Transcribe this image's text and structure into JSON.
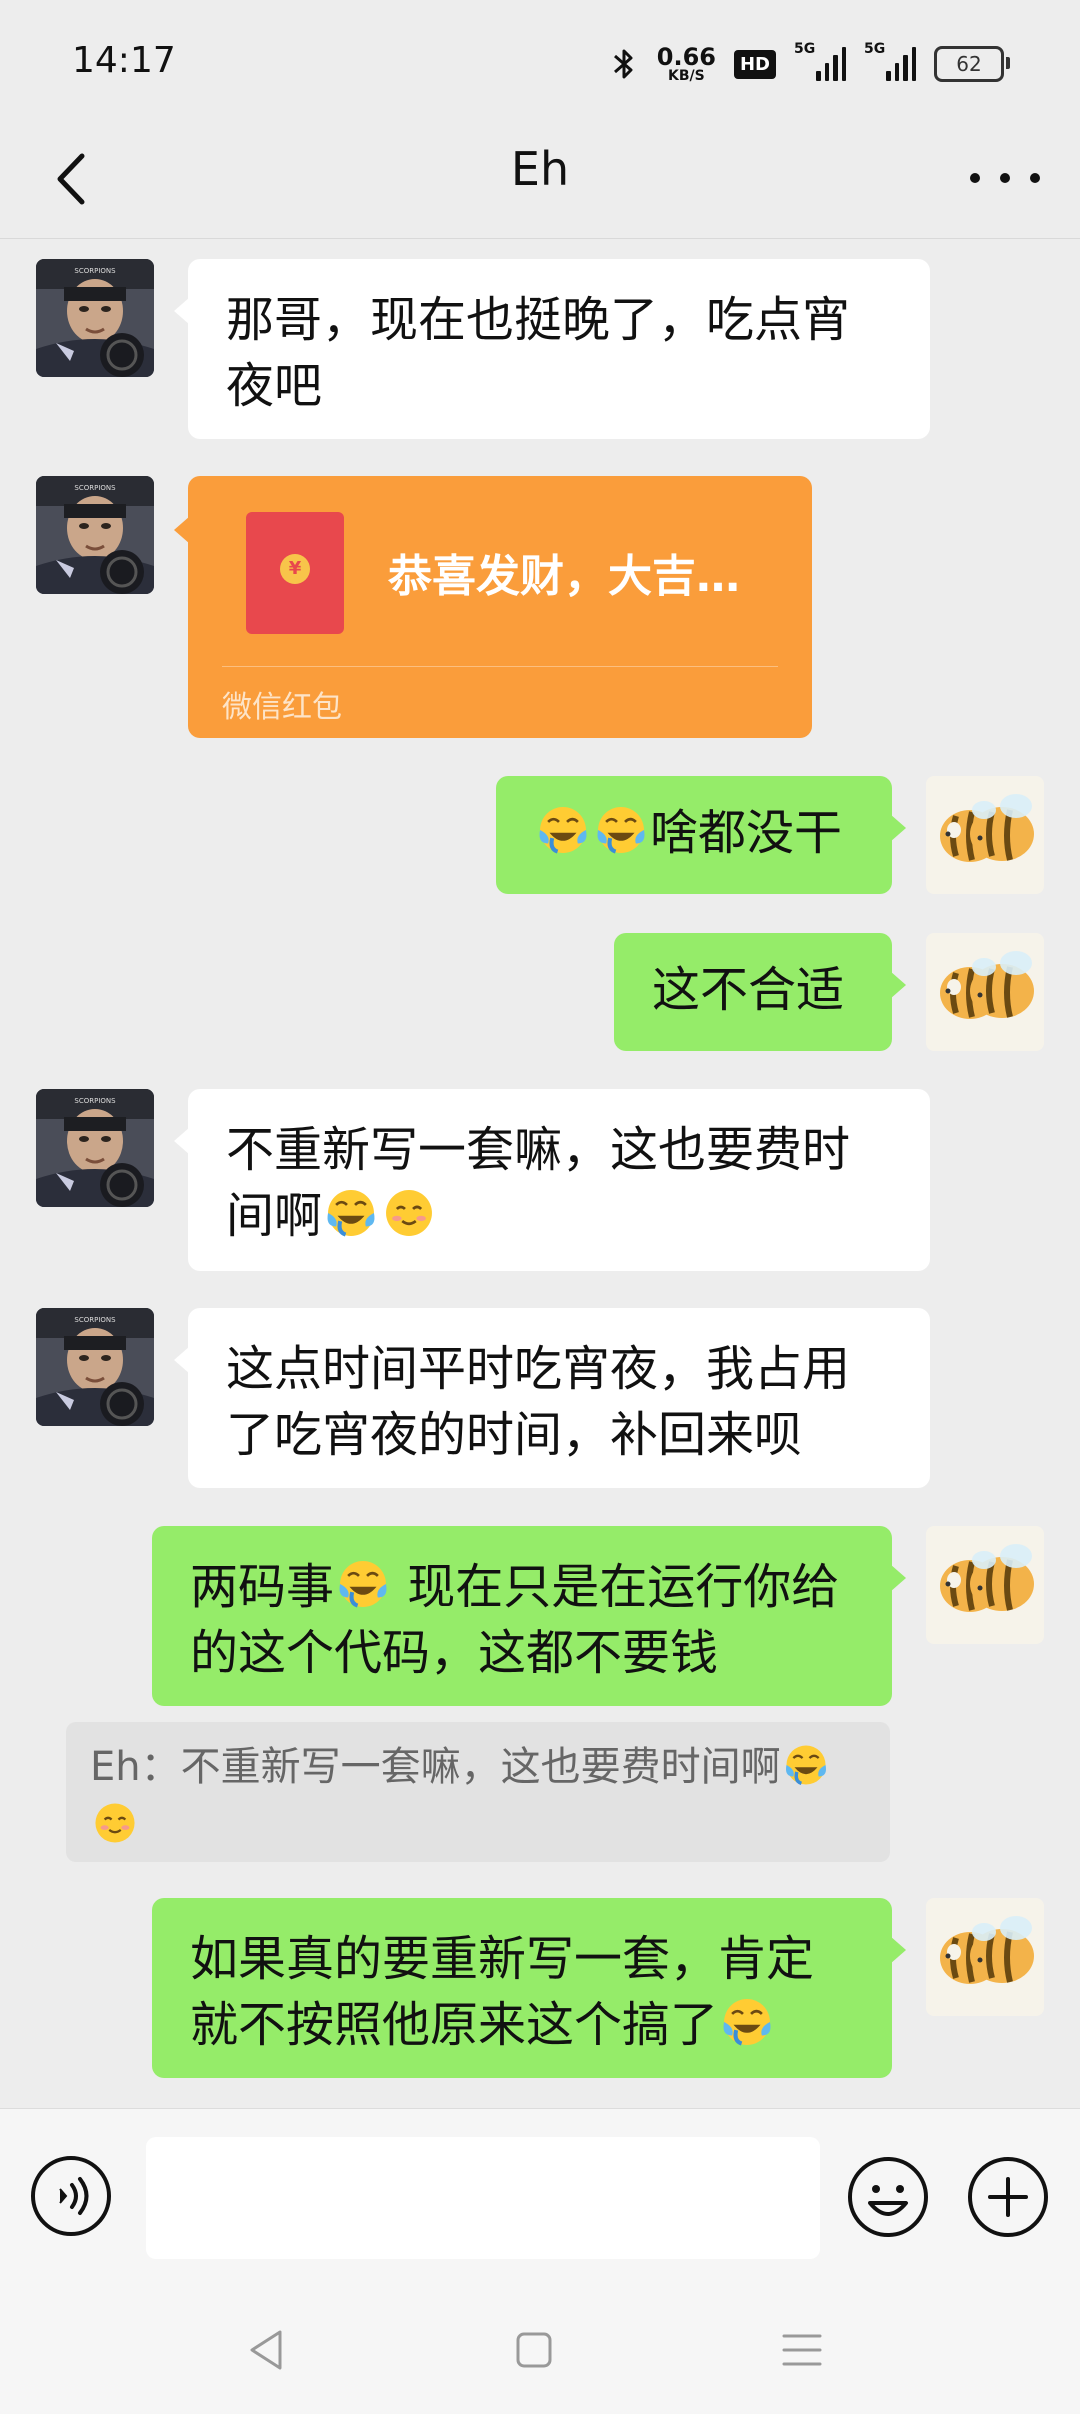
{
  "status_bar": {
    "time": "14:17",
    "net_speed": "0.66",
    "net_unit": "KB/S",
    "hd": "HD",
    "signal1": "5G",
    "signal2": "5G",
    "battery": "62"
  },
  "header": {
    "title": "Eh",
    "back_icon": "chevron-left-icon",
    "more_icon": "more-dots-icon"
  },
  "messages": [
    {
      "id": "m1",
      "side": "in",
      "text": "那哥，现在也挺晚了，吃点宵夜吧"
    },
    {
      "id": "m2",
      "side": "in",
      "type": "red-packet",
      "title": "恭喜发财，大吉…",
      "label": "微信红包"
    },
    {
      "id": "m3",
      "side": "out",
      "text": "啥都没干",
      "emoji_prefix": [
        "tears-of-joy-emoji",
        "tears-of-joy-emoji"
      ]
    },
    {
      "id": "m4",
      "side": "out",
      "text": "这不合适"
    },
    {
      "id": "m5",
      "side": "in",
      "text_part1": "不重新写一套嘛，这也要费时",
      "text_part2": "间啊",
      "emoji_suffix": [
        "tears-of-joy-emoji",
        "smiling-emoji"
      ]
    },
    {
      "id": "m6",
      "side": "in",
      "text_part1": "这点时间平时吃宵夜，我占用",
      "text_part2": "了吃宵夜的时间，补回来呗"
    },
    {
      "id": "m7",
      "side": "out",
      "text_part1": "两码事",
      "text_part2": " 现在只是在运行你给",
      "text_part3": "的这个代码，这都不要钱"
    },
    {
      "id": "q1",
      "type": "quote",
      "text": "Eh：不重新写一套嘛，这也要费时间啊"
    },
    {
      "id": "m8",
      "side": "out",
      "text_part1": "如果真的要重新写一套，肯定",
      "text_part2": "就不按照他原来这个搞了"
    }
  ],
  "input_bar": {
    "voice_icon": "voice-icon",
    "emoji_icon": "emoji-icon",
    "plus_icon": "plus-icon"
  },
  "colors": {
    "background": "#ededed",
    "outgoing_bubble": "#95ec69",
    "incoming_bubble": "#ffffff",
    "red_packet": "#fa9d3b"
  }
}
